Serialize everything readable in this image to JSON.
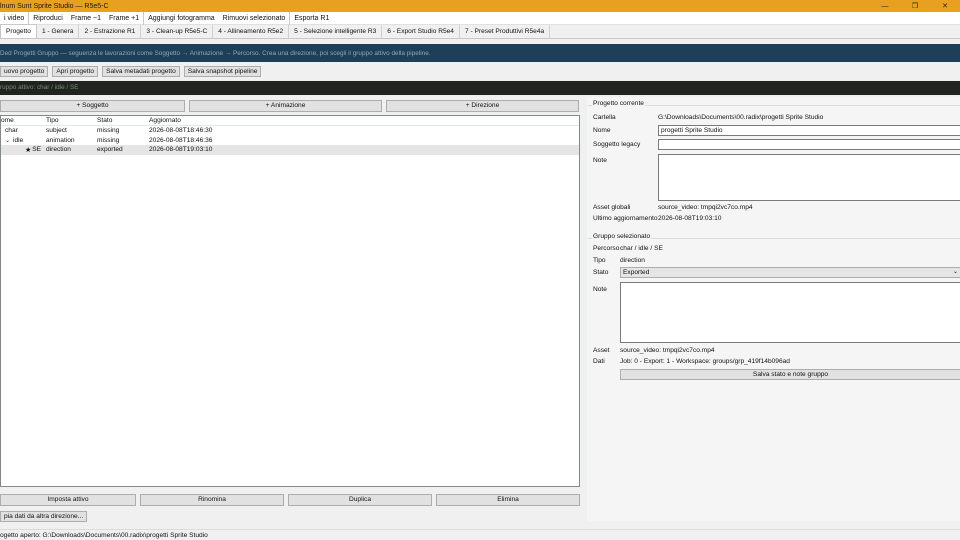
{
  "window": {
    "title": "lnum Sunt Sprite Studio — R5e5-C",
    "min_icon": "minimize-icon",
    "max_icon": "restore-icon",
    "close_icon": "close-icon",
    "min_glyph": "—",
    "max_glyph": "❐",
    "close_glyph": "✕"
  },
  "menu": [
    "i video",
    "Riproduci",
    "Frame −1",
    "Frame +1",
    "Aggiungi fotogramma",
    "Rimuovi selezionato",
    "Esporta R1"
  ],
  "tabs": [
    "Progetto",
    "1 - Genera",
    "2 - Estrazione R1",
    "3 - Clean-up R5e5-C",
    "4 - Allineamento R5e2",
    "5 - Selezione intelligente R3",
    "6 - Export Studio R5e4",
    "7 - Preset Produttivi R5e4a"
  ],
  "info_text": "Ded Progetti Gruppo — seguenza le lavorazioni come Soggetto → Animazione → Percorso. Crea una direzione, poi scegli il gruppo attivo della pipeline.",
  "toolbar": {
    "new": "uovo progetto",
    "open": "Apri progetto",
    "save_meta": "Salva metadati progetto",
    "save_snapshot": "Salva snapshot pipeline"
  },
  "active_group_text": "ruppo attivo: char / idle / SE",
  "add_buttons": {
    "subject": "+ Soggetto",
    "animation": "+ Animazione",
    "direction": "+ Direzione"
  },
  "tree": {
    "headers": {
      "name": "ome",
      "type": "Tipo",
      "state": "Stato",
      "updated": "Aggiornato"
    },
    "rows": [
      {
        "name": "char",
        "type": "subject",
        "state": "missing",
        "updated": "2026-08-08T18:46:30",
        "indent": 0,
        "chevron": "",
        "star": ""
      },
      {
        "name": "idle",
        "type": "animation",
        "state": "missing",
        "updated": "2026-08-08T18:46:36",
        "indent": 0,
        "chevron": "⌄",
        "star": ""
      },
      {
        "name": "SE",
        "type": "direction",
        "state": "exported",
        "updated": "2026-08-08T19:03:10",
        "indent": 2,
        "chevron": "",
        "star": "★"
      }
    ]
  },
  "bottom_buttons": {
    "set_active": "Imposta attivo",
    "rename": "Rinomina",
    "duplicate": "Duplica",
    "delete": "Elimina"
  },
  "copy_button": "pia dati da altra direzione...",
  "current_project": {
    "title": "Progetto corrente",
    "folder_label": "Cartella",
    "folder_value": "G:\\Downloads\\Documents\\00.radix\\progetti Sprite Studio",
    "name_label": "Nome",
    "name_value": "progetti Sprite Studio",
    "legacy_label": "Soggetto legacy",
    "legacy_value": "",
    "notes_label": "Note",
    "notes_value": "",
    "global_assets_label": "Asset globali",
    "global_assets_value": "source_video: tmpqi2vc7co.mp4",
    "last_update_label": "Ultimo aggiornamento",
    "last_update_value": "2026-08-08T19:03:10"
  },
  "selected_group": {
    "title": "Gruppo selezionato",
    "path_label": "Percorso",
    "path_value": "char / idle / SE",
    "type_label": "Tipo",
    "type_value": "direction",
    "state_label": "Stato",
    "state_value": "Exported",
    "notes_label": "Note",
    "notes_value": "",
    "asset_label": "Asset",
    "asset_value": "source_video: tmpqi2vc7co.mp4",
    "data_label": "Dati",
    "data_value": "Job: 0 - Export: 1 - Workspace: groups/grp_419f14b096ad",
    "save_button": "Salva stato e note gruppo"
  },
  "status_text": "ogetto aperto: G:\\Downloads\\Documents\\00.radix\\progetti Sprite Studio"
}
